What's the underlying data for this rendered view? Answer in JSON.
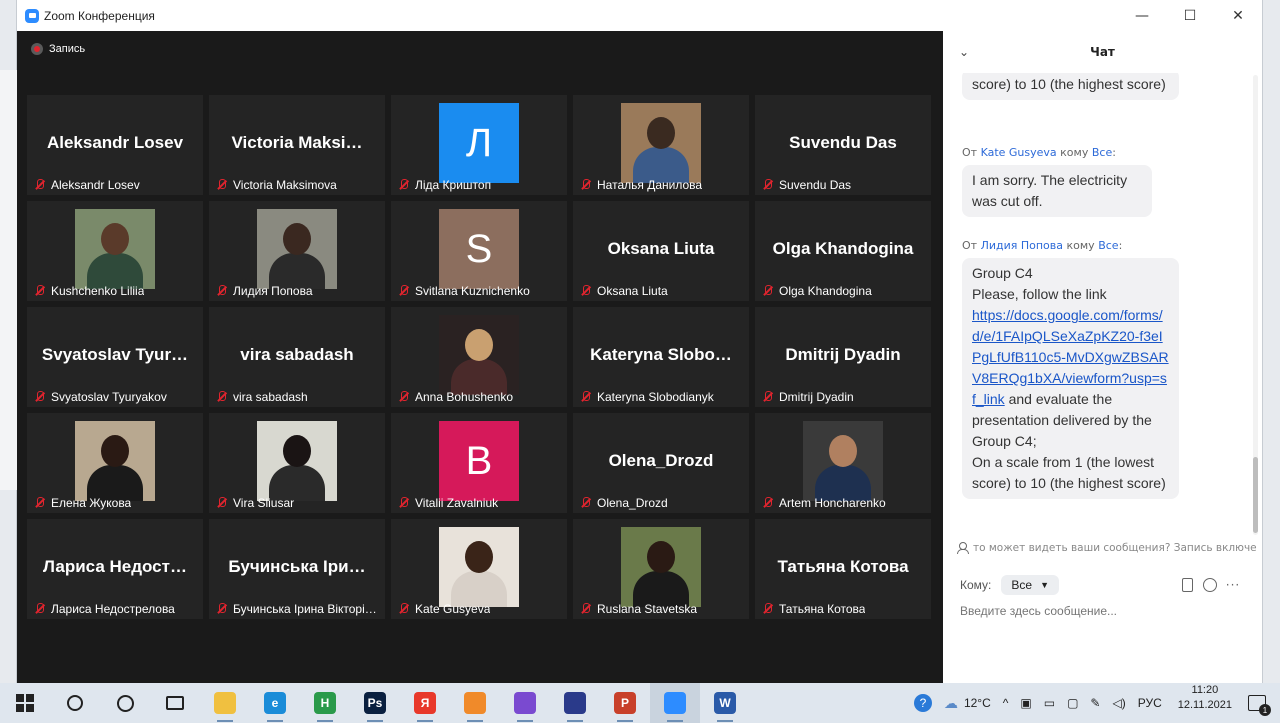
{
  "window": {
    "title": "Zoom Конференция",
    "minimize": "—",
    "maximize": "☐",
    "close": "✕"
  },
  "recording": {
    "label": "Запись"
  },
  "tiles": [
    {
      "display": "Aleksandr Losev",
      "label": "Aleksandr Losev",
      "kind": "name"
    },
    {
      "display": "Victoria  Maksi…",
      "label": "Victoria Maksimova",
      "kind": "name"
    },
    {
      "display": "Л",
      "label": "Ліда Криштоп",
      "kind": "avatar",
      "color": "#1a8cf0"
    },
    {
      "display": "",
      "label": "Наталья Данилова",
      "kind": "photo",
      "bg": "#9a7a5a",
      "head": "#3a2a20",
      "body": "#3b5b8a"
    },
    {
      "display": "Suvendu Das",
      "label": "Suvendu Das",
      "kind": "name"
    },
    {
      "display": "",
      "label": "Kushchenko Liliia",
      "kind": "photo",
      "bg": "#7a8a6a",
      "head": "#5a3a2a",
      "body": "#2f4a3a"
    },
    {
      "display": "",
      "label": "Лидия Попова",
      "kind": "photo",
      "bg": "#8a8a80",
      "head": "#3a2820",
      "body": "#2a2a2a"
    },
    {
      "display": "S",
      "label": "Svitlana Kuznichenko",
      "kind": "avatar",
      "color": "#8c6e5e"
    },
    {
      "display": "Oksana Liuta",
      "label": "Oksana Liuta",
      "kind": "name"
    },
    {
      "display": "Olga Khandogina",
      "label": "Olga Khandogina",
      "kind": "name"
    },
    {
      "display": "Svyatoslav  Tyur…",
      "label": "Svyatoslav Tyuryakov",
      "kind": "name"
    },
    {
      "display": "vira sabadash",
      "label": "vira sabadash",
      "kind": "name"
    },
    {
      "display": "",
      "label": "Anna Bohushenko",
      "kind": "photo",
      "bg": "#2a2222",
      "head": "#c9a070",
      "body": "#4a2a2a"
    },
    {
      "display": "Kateryna  Slobo…",
      "label": "Kateryna Slobodianyk",
      "kind": "name"
    },
    {
      "display": "Dmitrij Dyadin",
      "label": "Dmitrij Dyadin",
      "kind": "name"
    },
    {
      "display": "",
      "label": "Елена Жукова",
      "kind": "photo",
      "bg": "#b8a890",
      "head": "#2a1a14",
      "body": "#1a1a1a"
    },
    {
      "display": "",
      "label": "Vira Sliusar",
      "kind": "photo",
      "bg": "#d8d8d0",
      "head": "#1a1414",
      "body": "#2a2a2a"
    },
    {
      "display": "В",
      "label": "Vitalii Zavalniuk",
      "kind": "avatar",
      "color": "#d6195a"
    },
    {
      "display": "Olena_Drozd",
      "label": "Olena_Drozd",
      "kind": "name"
    },
    {
      "display": "",
      "label": "Artem Honcharenko",
      "kind": "photo",
      "bg": "#3a3a3a",
      "head": "#b08060",
      "body": "#1e3050"
    },
    {
      "display": "Лариса  Недост…",
      "label": "Лариса Недострелова",
      "kind": "name"
    },
    {
      "display": "Бучинська  Іри…",
      "label": "Бучинська Ірина Вікторі…",
      "kind": "name"
    },
    {
      "display": "",
      "label": "Kate Gusyeva",
      "kind": "photo",
      "bg": "#e8e2da",
      "head": "#3a2418",
      "body": "#d8d0c8"
    },
    {
      "display": "",
      "label": "Ruslana Stavetska",
      "kind": "photo",
      "bg": "#6a7a4a",
      "head": "#2a1a14",
      "body": "#1a1a1a"
    },
    {
      "display": "Татьяна Котова",
      "label": "Татьяна Котова",
      "kind": "name"
    }
  ],
  "chat": {
    "title": "Чат",
    "collapse_icon": "⌄",
    "msg0_text": "score) to 10 (the highest score)",
    "msg1_from_prefix": "От ",
    "msg1_from": "Kate Gusyeva",
    "msg1_to_mid": " кому ",
    "msg1_to": "Все",
    "msg1_to_suffix": ":",
    "msg1_text": "I am sorry. The electricity was cut off.",
    "msg2_from_prefix": "От ",
    "msg2_from": "Лидия Попова",
    "msg2_to_mid": " кому ",
    "msg2_to": "Все",
    "msg2_to_suffix": ":",
    "msg2_line1": "Group C4",
    "msg2_line2": "Please, follow the link",
    "msg2_link": "https://docs.google.com/forms/d/e/1FAIpQLSeXaZpKZ20-f3eIPgLfUfB110c5-MvDXgwZBSARV8ERQg1bXA/viewform?usp=sf_link",
    "msg2_after_link": " and evaluate the presentation delivered by the Group C4;",
    "msg2_line4": "On a scale from 1 (the lowest score) to 10 (the highest score)",
    "privacy_text": "то может видеть ваши сообщения? Запись включе",
    "to_label": "Кому:",
    "to_value": "Все",
    "input_placeholder": "Введите здесь сообщение..."
  },
  "taskbar": {
    "apps": [
      {
        "name": "file-explorer",
        "glyph": "",
        "color": "#f0c040"
      },
      {
        "name": "edge",
        "glyph": "e",
        "color": "#1a8cd8"
      },
      {
        "name": "chrome-profile",
        "glyph": "Н",
        "color": "#2a9a4a"
      },
      {
        "name": "photoshop",
        "glyph": "Ps",
        "color": "#0a2040"
      },
      {
        "name": "yandex",
        "glyph": "Я",
        "color": "#e8382a"
      },
      {
        "name": "app-orange",
        "glyph": "",
        "color": "#f08a2a"
      },
      {
        "name": "viber",
        "glyph": "",
        "color": "#7a4ad0"
      },
      {
        "name": "save-app",
        "glyph": "",
        "color": "#2a3a8a"
      },
      {
        "name": "powerpoint",
        "glyph": "P",
        "color": "#c8402a"
      },
      {
        "name": "zoom",
        "glyph": "",
        "color": "#2d8cff"
      },
      {
        "name": "word",
        "glyph": "W",
        "color": "#2a5aa8"
      }
    ],
    "weather": "12°C",
    "language": "РУС",
    "time": "11:20",
    "date": "12.11.2021",
    "notifications": "1"
  }
}
